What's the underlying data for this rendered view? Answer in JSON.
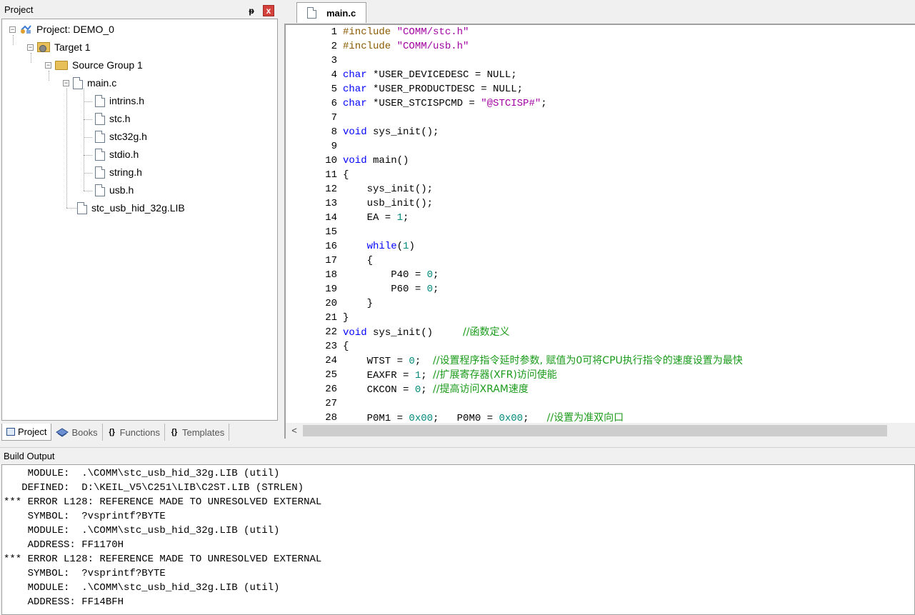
{
  "project_panel": {
    "title": "Project",
    "pin_glyph": "ᵽ",
    "close_glyph": "x",
    "tree": [
      {
        "label": "Project: DEMO_0",
        "icon": "project-icon"
      },
      {
        "label": "Target 1",
        "icon": "target-icon"
      },
      {
        "label": "Source Group 1",
        "icon": "folder-icon"
      },
      {
        "label": "main.c",
        "icon": "file-icon"
      },
      {
        "label": "intrins.h",
        "icon": "file-icon"
      },
      {
        "label": "stc.h",
        "icon": "file-icon"
      },
      {
        "label": "stc32g.h",
        "icon": "file-icon"
      },
      {
        "label": "stdio.h",
        "icon": "file-icon"
      },
      {
        "label": "string.h",
        "icon": "file-icon"
      },
      {
        "label": "usb.h",
        "icon": "file-icon"
      },
      {
        "label": "stc_usb_hid_32g.LIB",
        "icon": "file-icon"
      }
    ],
    "tabs": [
      {
        "label": "Project",
        "icon": "project-tab-icon"
      },
      {
        "label": "Books",
        "icon": "books-icon"
      },
      {
        "label": "Functions",
        "icon": "functions-icon",
        "glyph": "{}"
      },
      {
        "label": "Templates",
        "icon": "templates-icon",
        "glyph": "{}"
      }
    ]
  },
  "editor": {
    "tab_label": "main.c",
    "scroll_left_glyph": "<",
    "lines": [
      {
        "n": "1",
        "parts": [
          [
            "pp",
            "#include "
          ],
          [
            "s",
            "\"COMM/stc.h\""
          ]
        ]
      },
      {
        "n": "2",
        "parts": [
          [
            "pp",
            "#include "
          ],
          [
            "s",
            "\"COMM/usb.h\""
          ]
        ]
      },
      {
        "n": "3",
        "parts": []
      },
      {
        "n": "4",
        "parts": [
          [
            "k",
            "char"
          ],
          [
            "t",
            " *USER_DEVICEDESC = NULL;"
          ]
        ]
      },
      {
        "n": "5",
        "parts": [
          [
            "k",
            "char"
          ],
          [
            "t",
            " *USER_PRODUCTDESC = NULL;"
          ]
        ]
      },
      {
        "n": "6",
        "parts": [
          [
            "k",
            "char"
          ],
          [
            "t",
            " *USER_STCISPCMD = "
          ],
          [
            "s",
            "\"@STCISP#\""
          ],
          [
            "t",
            ";"
          ]
        ]
      },
      {
        "n": "7",
        "parts": []
      },
      {
        "n": "8",
        "parts": [
          [
            "k",
            "void"
          ],
          [
            "t",
            " sys_init();"
          ]
        ]
      },
      {
        "n": "9",
        "parts": []
      },
      {
        "n": "10",
        "parts": [
          [
            "k",
            "void"
          ],
          [
            "t",
            " main()"
          ]
        ]
      },
      {
        "n": "11",
        "parts": [
          [
            "t",
            "{"
          ]
        ]
      },
      {
        "n": "12",
        "parts": [
          [
            "t",
            "    sys_init();"
          ]
        ]
      },
      {
        "n": "13",
        "parts": [
          [
            "t",
            "    usb_init();"
          ]
        ]
      },
      {
        "n": "14",
        "parts": [
          [
            "t",
            "    EA = "
          ],
          [
            "n",
            "1"
          ],
          [
            "t",
            ";"
          ]
        ]
      },
      {
        "n": "15",
        "parts": []
      },
      {
        "n": "16",
        "parts": [
          [
            "t",
            "    "
          ],
          [
            "k",
            "while"
          ],
          [
            "t",
            "("
          ],
          [
            "n",
            "1"
          ],
          [
            "t",
            ")"
          ]
        ]
      },
      {
        "n": "17",
        "parts": [
          [
            "t",
            "    {"
          ]
        ]
      },
      {
        "n": "18",
        "parts": [
          [
            "t",
            "        P40 = "
          ],
          [
            "n",
            "0"
          ],
          [
            "t",
            ";"
          ]
        ]
      },
      {
        "n": "19",
        "parts": [
          [
            "t",
            "        P60 = "
          ],
          [
            "n",
            "0"
          ],
          [
            "t",
            ";"
          ]
        ]
      },
      {
        "n": "20",
        "parts": [
          [
            "t",
            "    }"
          ]
        ]
      },
      {
        "n": "21",
        "parts": [
          [
            "t",
            "}"
          ]
        ]
      },
      {
        "n": "22",
        "parts": [
          [
            "k",
            "void"
          ],
          [
            "t",
            " sys_init()     "
          ],
          [
            "c",
            "//函数定义"
          ]
        ]
      },
      {
        "n": "23",
        "parts": [
          [
            "t",
            "{"
          ]
        ]
      },
      {
        "n": "24",
        "parts": [
          [
            "t",
            "    WTST = "
          ],
          [
            "n",
            "0"
          ],
          [
            "t",
            ";  "
          ],
          [
            "c",
            "//设置程序指令延时参数, 赋值为0可将CPU执行指令的速度设置为最快"
          ]
        ]
      },
      {
        "n": "25",
        "parts": [
          [
            "t",
            "    EAXFR = "
          ],
          [
            "n",
            "1"
          ],
          [
            "t",
            "; "
          ],
          [
            "c",
            "//扩展寄存器(XFR)访问使能"
          ]
        ]
      },
      {
        "n": "26",
        "parts": [
          [
            "t",
            "    CKCON = "
          ],
          [
            "n",
            "0"
          ],
          [
            "t",
            "; "
          ],
          [
            "c",
            "//提高访问XRAM速度"
          ]
        ]
      },
      {
        "n": "27",
        "parts": []
      },
      {
        "n": "28",
        "parts": [
          [
            "t",
            "    P0M1 = "
          ],
          [
            "n",
            "0x00"
          ],
          [
            "t",
            ";   P0M0 = "
          ],
          [
            "n",
            "0x00"
          ],
          [
            "t",
            ";   "
          ],
          [
            "c",
            "//设置为准双向口"
          ]
        ]
      }
    ]
  },
  "build_output": {
    "title": "Build Output",
    "lines": [
      "    MODULE:  .\\COMM\\stc_usb_hid_32g.LIB (util)",
      "   DEFINED:  D:\\KEIL_V5\\C251\\LIB\\C2ST.LIB (STRLEN)",
      "*** ERROR L128: REFERENCE MADE TO UNRESOLVED EXTERNAL",
      "    SYMBOL:  ?vsprintf?BYTE",
      "    MODULE:  .\\COMM\\stc_usb_hid_32g.LIB (util)",
      "    ADDRESS: FF1170H",
      "*** ERROR L128: REFERENCE MADE TO UNRESOLVED EXTERNAL",
      "    SYMBOL:  ?vsprintf?BYTE",
      "    MODULE:  .\\COMM\\stc_usb_hid_32g.LIB (util)",
      "    ADDRESS: FF14BFH"
    ]
  }
}
